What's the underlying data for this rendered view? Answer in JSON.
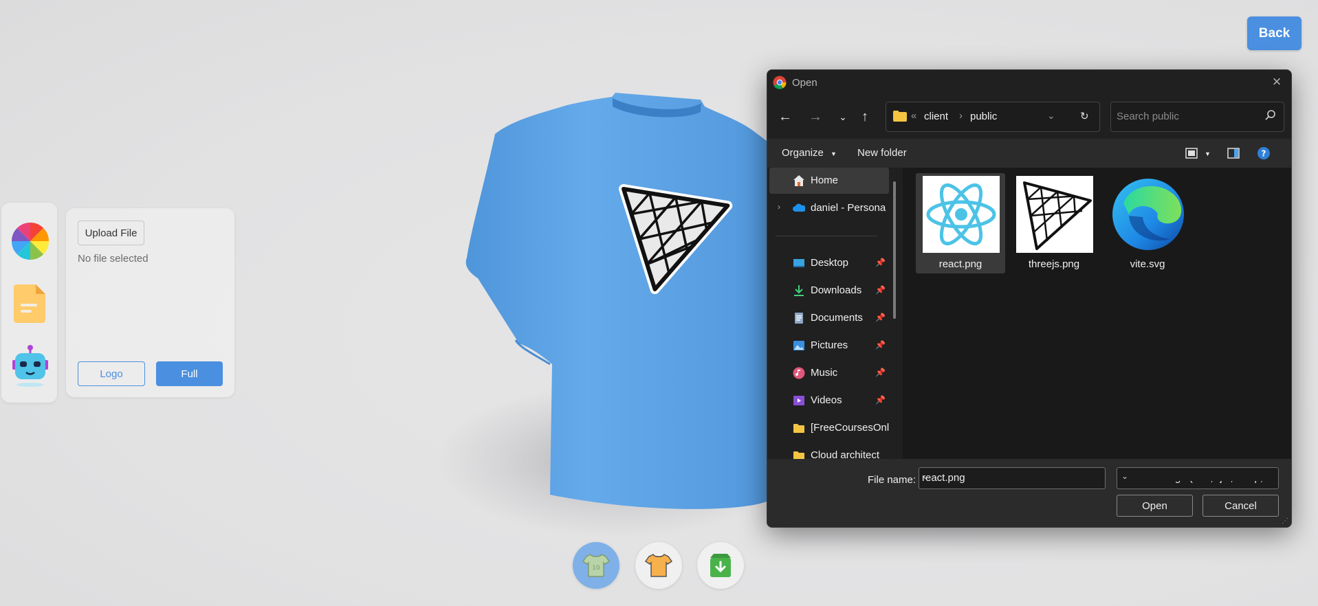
{
  "header": {
    "back_label": "Back"
  },
  "tabs": {
    "items": [
      {
        "name": "colorpicker",
        "icon": "color-wheel-icon"
      },
      {
        "name": "filepicker",
        "icon": "file-icon"
      },
      {
        "name": "aipicker",
        "icon": "robot-icon"
      }
    ]
  },
  "filepicker": {
    "upload_label": "Upload File",
    "status": "No file selected",
    "logo_label": "Logo",
    "full_label": "Full"
  },
  "shirt": {
    "color": "#5ea3e6"
  },
  "bottom_tabs": [
    {
      "name": "logo-shirt-tab",
      "icon": "logo-shirt-icon",
      "active": true
    },
    {
      "name": "stylish-shirt-tab",
      "icon": "stylish-shirt-icon",
      "active": false
    },
    {
      "name": "download-tab",
      "icon": "download-icon",
      "active": false
    }
  ],
  "dialog": {
    "title": "Open",
    "address": {
      "parent_hint": "«",
      "crumbs": [
        "client",
        "public"
      ]
    },
    "search_placeholder": "Search public",
    "commands": {
      "organize": "Organize",
      "new_folder": "New folder"
    },
    "nav_items": [
      {
        "label": "Home",
        "icon": "home-icon",
        "pinned": false,
        "selected": true
      },
      {
        "label": "daniel - Persona",
        "icon": "onedrive-cloud-icon",
        "pinned": false,
        "selected": false
      },
      {
        "label": "Desktop",
        "icon": "desktop-icon",
        "pinned": true
      },
      {
        "label": "Downloads",
        "icon": "downloads-icon",
        "pinned": true
      },
      {
        "label": "Documents",
        "icon": "documents-icon",
        "pinned": true
      },
      {
        "label": "Pictures",
        "icon": "pictures-icon",
        "pinned": true
      },
      {
        "label": "Music",
        "icon": "music-icon",
        "pinned": true
      },
      {
        "label": "Videos",
        "icon": "videos-icon",
        "pinned": true
      },
      {
        "label": "[FreeCoursesOnl",
        "icon": "folder-icon",
        "pinned": false
      },
      {
        "label": "Cloud architect",
        "icon": "folder-icon",
        "pinned": false
      }
    ],
    "files": [
      {
        "name": "react.png",
        "icon": "react-logo-icon",
        "selected": true
      },
      {
        "name": "threejs.png",
        "icon": "threejs-logo-icon",
        "selected": false
      },
      {
        "name": "vite.svg",
        "icon": "edge-browser-icon",
        "selected": false
      }
    ],
    "file_name_label": "File name:",
    "file_name_value": "react.png",
    "filter_value": "Fichiers image (*.tiff;*.jfif;*.bmp;",
    "open_label": "Open",
    "cancel_label": "Cancel"
  }
}
